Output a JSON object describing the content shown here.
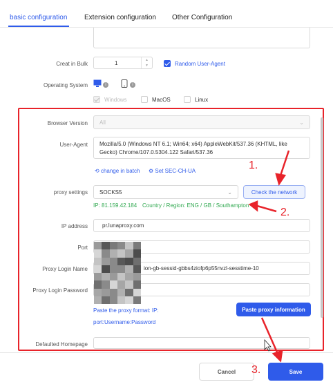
{
  "tabs": [
    {
      "label": "basic configuration"
    },
    {
      "label": "Extension configuration"
    },
    {
      "label": "Other Configuration"
    }
  ],
  "form": {
    "creat_in_bulk_label": "Creat in Bulk",
    "creat_in_bulk_value": "1",
    "random_ua_label": "Random User-Agent",
    "os_label": "Operating System",
    "os_options": [
      "Windows",
      "MacOS",
      "Linux"
    ],
    "browser_version_label": "Browser Version",
    "browser_version_value": "All",
    "user_agent_label": "User-Agent",
    "user_agent_value": "Mozilla/5.0 (Windows NT 6.1; Win64; x64) AppleWebKit/537.36 (KHTML, like Gecko) Chrome/107.0.5304.122 Safari/537.36",
    "change_in_batch": "change in batch",
    "set_sec_ch_ua": "Set SEC-CH-UA",
    "proxy_settings_label": "proxy settings",
    "proxy_type": "SOCKS5",
    "check_network": "Check the network",
    "proxy_ip": "IP: 81.159.42.184",
    "proxy_region": "Country / Region: ENG / GB / Southampton",
    "ip_address_label": "IP address",
    "ip_address_value": "pr.lunaproxy.com",
    "port_label": "Port",
    "port_value": "",
    "proxy_login_name_label": "Proxy Login Name",
    "proxy_login_name_value": "ion-gb-sessid-gbbs4ziofp6p55nvzl-sesstime-10",
    "proxy_login_password_label": "Proxy Login Password",
    "paste_format_line1": "Paste the proxy format: IP:",
    "paste_format_line2": "port:Username:Password",
    "paste_proxy_btn": "Paste proxy information",
    "defaulted_homepage_label": "Defaulted Homepage"
  },
  "footer": {
    "cancel": "Cancel",
    "save": "Save"
  },
  "annotations": {
    "a1": "1.",
    "a2": "2.",
    "a3": "3."
  },
  "colors": {
    "accent": "#2f5bea",
    "success": "#2fa84f",
    "annotation": "#e8232a"
  }
}
